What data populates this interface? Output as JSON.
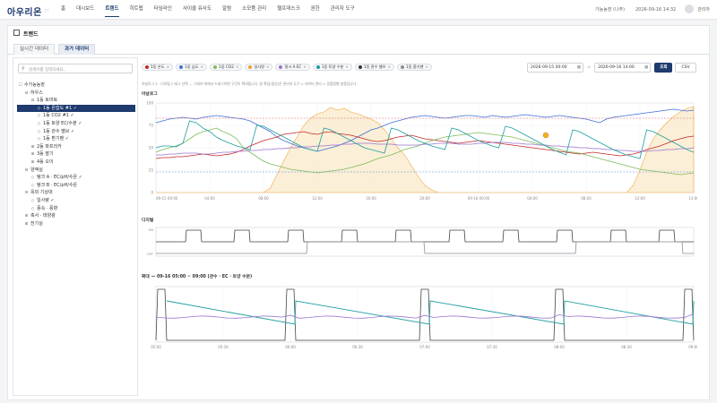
{
  "app": {
    "logo": "아우리온",
    "logo_sub": "| |"
  },
  "nav": [
    "홈",
    "대시보드",
    "트렌드",
    "히트맵",
    "타임라인",
    "사이클 유사도",
    "알람",
    "소모품 관리",
    "헬프데스크",
    "권한",
    "관리자 도구"
  ],
  "nav_active_index": 2,
  "header_right": {
    "farm": "가능농장 (나주)",
    "datetime": "2026-09-16 14:32",
    "user": "관리자"
  },
  "page": {
    "title": "트렌드"
  },
  "tabs": [
    "실시간 데이터",
    "과거 데이터"
  ],
  "tabs_active_index": 1,
  "tree": {
    "search_placeholder": "검색어를 입력하세요..",
    "nodes": [
      {
        "label": "수가능농장",
        "level": 0,
        "toggle": "☐"
      },
      {
        "label": "하우스",
        "level": 1,
        "toggle": "⊟"
      },
      {
        "label": "1동 토마토",
        "level": 2,
        "toggle": "⊟"
      },
      {
        "label": "1동 온습도 #1 ✓",
        "level": 3,
        "toggle": "◇",
        "selected": true
      },
      {
        "label": "1동 CO2 #1 ✓",
        "level": 3,
        "toggle": "◇"
      },
      {
        "label": "1동 토양 EC/수분 ✓",
        "level": 3,
        "toggle": "◇"
      },
      {
        "label": "1동 관수 밸브 ✓",
        "level": 3,
        "toggle": "◇"
      },
      {
        "label": "1동 환기팬 ✓",
        "level": 3,
        "toggle": "◇"
      },
      {
        "label": "2동 파프리카",
        "level": 2,
        "toggle": "⊞"
      },
      {
        "label": "3동 딸기",
        "level": 2,
        "toggle": "⊞"
      },
      {
        "label": "4동 오이",
        "level": 2,
        "toggle": "⊞"
      },
      {
        "label": "양액실",
        "level": 1,
        "toggle": "⊟"
      },
      {
        "label": "탱크 A · EC/pH/수온 ✓",
        "level": 2,
        "toggle": "◇"
      },
      {
        "label": "탱크 B · EC/pH/수온",
        "level": 2,
        "toggle": "◇"
      },
      {
        "label": "옥외 기상대",
        "level": 1,
        "toggle": "⊟"
      },
      {
        "label": "일사량 ✓",
        "level": 2,
        "toggle": "◇"
      },
      {
        "label": "풍속 · 풍향",
        "level": 2,
        "toggle": "◇"
      },
      {
        "label": "축사 · 태양광",
        "level": 1,
        "toggle": "⊞"
      },
      {
        "label": "전기실",
        "level": 1,
        "toggle": "⊞"
      }
    ]
  },
  "chips": [
    {
      "label": "1동 온도",
      "color": "#c62828"
    },
    {
      "label": "1동 습도",
      "color": "#3f6fd8"
    },
    {
      "label": "1동 CO2",
      "color": "#7cbb5a"
    },
    {
      "label": "일사량",
      "color": "#f0a030"
    },
    {
      "label": "탱크 A EC",
      "color": "#9a72d0"
    },
    {
      "label": "1동 토양 수분",
      "color": "#1e9e9e"
    },
    {
      "label": "1동 관수 밸브",
      "color": "#333333"
    },
    {
      "label": "1동 환기팬",
      "color": "#8a8f99"
    }
  ],
  "chip_remove_glyph": "×",
  "date_range": {
    "from": "2026-09-15 00:00",
    "to": "2026-09-16 14:00",
    "separator": "~",
    "search_label": "조회",
    "csv_label": "CSV"
  },
  "hint": "아날로그 3 · 디지털 2 태그 선택 — 그래프 위에서 드래그하면 구간이 확대됩니다. 창 확장(접선)은 관리자 도구 > 데이터 관리 > 경쟁정렬 설정입니다.",
  "colors": {
    "accent": "#1e3a6e",
    "threshold_red": "#e06060",
    "threshold_blue": "#5a8de0",
    "solar_fill": "#fbeed3"
  },
  "chart_data": [
    {
      "type": "line",
      "title": "아날로그",
      "ylim": [
        0,
        100
      ],
      "yticks": [
        "100",
        "75",
        "50",
        "25",
        "0"
      ],
      "xticks": [
        "09-15 00:00",
        "04:00",
        "08:00",
        "12:00",
        "16:00",
        "20:00",
        "09-16 00:00",
        "04:00",
        "08:00",
        "12:00",
        "13:00"
      ],
      "thresholds": [
        {
          "value": 83,
          "color": "#e06060"
        },
        {
          "value": 23,
          "color": "#5a8de0"
        }
      ],
      "series": [
        {
          "key": "solar",
          "color": "#f0a030",
          "area": true,
          "values": [
            0,
            0,
            0,
            0,
            0,
            0,
            0,
            0,
            0,
            0,
            0,
            0,
            0,
            0,
            0,
            0,
            0,
            5,
            20,
            35,
            50,
            62,
            75,
            83,
            88,
            90,
            95,
            92,
            94,
            90,
            88,
            85,
            82,
            78,
            70,
            60,
            50,
            42,
            30,
            18,
            8,
            3,
            0,
            0,
            0,
            0,
            0,
            0,
            0,
            0,
            0,
            0,
            0,
            0,
            0,
            0,
            0,
            0,
            0,
            0,
            0,
            0,
            0,
            0,
            0,
            0,
            0,
            0,
            0,
            0,
            0,
            8,
            25,
            45,
            60,
            70,
            78,
            85,
            90,
            94,
            96
          ]
        },
        {
          "key": "humidity",
          "color": "#3f6fd8",
          "values": [
            78,
            80,
            82,
            83,
            84,
            83,
            82,
            84,
            85,
            86,
            85,
            84,
            83,
            82,
            80,
            76,
            72,
            68,
            62,
            58,
            55,
            52,
            50,
            48,
            46,
            48,
            50,
            52,
            55,
            58,
            62,
            66,
            70,
            72,
            75,
            78,
            80,
            82,
            84,
            85,
            86,
            85,
            84,
            83,
            84,
            85,
            86,
            86,
            85,
            84,
            86,
            85,
            84,
            85,
            86,
            87,
            86,
            85,
            84,
            85,
            86,
            85,
            84,
            83,
            82,
            80,
            78,
            82,
            84,
            85,
            86,
            87,
            88,
            89,
            90,
            91,
            92,
            93,
            92,
            91,
            92
          ]
        },
        {
          "key": "temp",
          "color": "#c62828",
          "values": [
            38,
            39,
            39,
            40,
            40,
            41,
            42,
            43,
            42,
            41,
            42,
            43,
            45,
            48,
            52,
            55,
            58,
            60,
            62,
            65,
            66,
            67,
            68,
            66,
            65,
            67,
            68,
            66,
            65,
            64,
            62,
            60,
            58,
            57,
            58,
            60,
            62,
            63,
            64,
            62,
            60,
            59,
            58,
            57,
            56,
            55,
            56,
            57,
            58,
            57,
            56,
            55,
            54,
            53,
            52,
            51,
            50,
            49,
            48,
            47,
            46,
            45,
            44,
            43,
            44,
            45,
            44,
            43,
            42,
            41,
            42,
            43,
            45,
            48,
            50,
            52,
            55,
            58,
            60,
            62,
            63
          ]
        },
        {
          "key": "co2",
          "color": "#7cbb5a",
          "values": [
            45,
            48,
            50,
            52,
            55,
            60,
            65,
            68,
            70,
            72,
            68,
            65,
            60,
            50,
            45,
            40,
            35,
            32,
            30,
            28,
            26,
            25,
            24,
            23,
            22,
            23,
            24,
            25,
            26,
            28,
            30,
            32,
            35,
            38,
            40,
            42,
            45,
            48,
            50,
            52,
            55,
            58,
            60,
            62,
            63,
            64,
            65,
            66,
            67,
            66,
            65,
            64,
            63,
            62,
            60,
            58,
            56,
            54,
            52,
            50,
            48,
            46,
            45,
            44,
            42,
            40,
            38,
            36,
            34,
            32,
            30,
            28,
            26,
            25,
            24,
            23,
            22,
            21,
            20,
            21,
            22
          ]
        },
        {
          "key": "ec",
          "color": "#9a72d0",
          "values": [
            42,
            42,
            43,
            43,
            44,
            44,
            44,
            43,
            43,
            44,
            45,
            45,
            46,
            46,
            47,
            47,
            48,
            48,
            49,
            49,
            50,
            50,
            51,
            51,
            52,
            52,
            53,
            53,
            54,
            54,
            55,
            55,
            55,
            54,
            54,
            54,
            53,
            53,
            53,
            53,
            54,
            54,
            55,
            55,
            55,
            54,
            54,
            54,
            55,
            55,
            56,
            56,
            56,
            55,
            55,
            54,
            54,
            53,
            53,
            52,
            52,
            51,
            51,
            50,
            50,
            49,
            49,
            48,
            48,
            47,
            47,
            46,
            46,
            46,
            47,
            47,
            48,
            48,
            49,
            49,
            50
          ]
        },
        {
          "key": "soil",
          "color": "#1e9e9e",
          "values": [
            50,
            52,
            52,
            51,
            55,
            80,
            78,
            72,
            68,
            62,
            58,
            55,
            52,
            50,
            48,
            75,
            74,
            70,
            66,
            62,
            58,
            54,
            50,
            48,
            46,
            72,
            70,
            66,
            62,
            58,
            54,
            50,
            48,
            46,
            44,
            72,
            70,
            66,
            62,
            58,
            55,
            52,
            50,
            48,
            72,
            70,
            66,
            62,
            58,
            55,
            52,
            50,
            74,
            72,
            68,
            64,
            60,
            56,
            52,
            48,
            45,
            42,
            70,
            68,
            64,
            60,
            56,
            52,
            48,
            45,
            42,
            40,
            38,
            70,
            68,
            64,
            60,
            56,
            52,
            48,
            45
          ]
        }
      ]
    },
    {
      "type": "line",
      "title": "디지털",
      "yticks": [
        "ON",
        "OFF"
      ],
      "series": [
        {
          "key": "valve",
          "color": "#444444",
          "on_segments": [
            [
              0.055,
              0.085
            ],
            [
              0.145,
              0.175
            ],
            [
              0.245,
              0.275
            ],
            [
              0.345,
              0.375
            ],
            [
              0.445,
              0.475
            ],
            [
              0.545,
              0.575
            ],
            [
              0.645,
              0.675
            ],
            [
              0.745,
              0.775
            ],
            [
              0.845,
              0.875
            ],
            [
              0.935,
              0.965
            ]
          ]
        },
        {
          "key": "fan",
          "color": "#8a8f99",
          "on_segments": [
            [
              0.28,
              0.5
            ],
            [
              0.78,
              0.98
            ]
          ]
        }
      ]
    },
    {
      "type": "line",
      "title": "확대 — 09-16 05:00 ~ 09:00 (관수 · EC · 토양 수분)",
      "xticks": [
        "05:00",
        "05:30",
        "06:00",
        "06:30",
        "07:00",
        "07:30",
        "08:00",
        "08:30",
        "09:00"
      ],
      "series": [
        {
          "key": "valve_z",
          "color": "#444444",
          "on_segments": [
            [
              0.0,
              0.02
            ],
            [
              0.24,
              0.26
            ],
            [
              0.49,
              0.51
            ],
            [
              0.74,
              0.76
            ],
            [
              0.98,
              1.0
            ]
          ]
        },
        {
          "key": "soil_z",
          "color": "#1e9e9e",
          "pulses": [
            0.02,
            0.26,
            0.51,
            0.76,
            1.0
          ]
        },
        {
          "key": "ec_z",
          "color": "#9a72d0",
          "level": 0.55
        }
      ]
    }
  ]
}
